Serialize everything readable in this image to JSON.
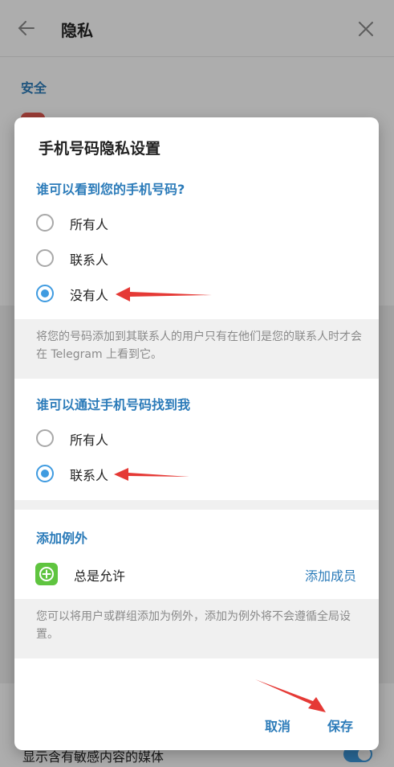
{
  "background": {
    "title": "隐私",
    "section_title": "安全",
    "bottom_item_label": "显示含有敏感内容的媒体"
  },
  "dialog": {
    "title": "手机号码隐私设置",
    "who_can_see": {
      "title": "谁可以看到您的手机号码?",
      "options": [
        "所有人",
        "联系人",
        "没有人"
      ],
      "selected": "没有人"
    },
    "who_can_see_info": "将您的号码添加到其联系人的用户只有在他们是您的联系人时才会在 Telegram 上看到它。",
    "who_can_find": {
      "title": "谁可以通过手机号码找到我",
      "options": [
        "所有人",
        "联系人"
      ],
      "selected": "联系人"
    },
    "exceptions": {
      "title": "添加例外",
      "always_allow_label": "总是允许",
      "add_members_link": "添加成员"
    },
    "exceptions_info": "您可以将用户或群组添加为例外，添加为例外将不会遵循全局设置。",
    "buttons": {
      "cancel": "取消",
      "save": "保存"
    }
  },
  "colors": {
    "accent": "#2b7bb9",
    "radio_checked": "#3f9be0",
    "annotation_arrow": "#e53935",
    "add_icon": "#5fc43f"
  }
}
